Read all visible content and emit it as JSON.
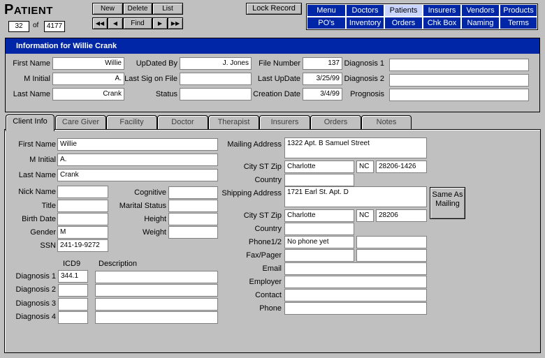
{
  "app": {
    "title_big": "P",
    "title_small": "ATIENT"
  },
  "record": {
    "current": "32",
    "of_label": "of",
    "total": "4177"
  },
  "toolbar": {
    "new": "New",
    "delete": "Delete",
    "list": "List",
    "first": "◀◀",
    "prev": "◀",
    "find": "Find",
    "next": "▶",
    "last": "▶▶",
    "lock": "Lock Record"
  },
  "nav": [
    "Menu",
    "Doctors",
    "Patients",
    "Insurers",
    "Vendors",
    "Products",
    "PO's",
    "Inventory",
    "Orders",
    "Chk Box",
    "Naming",
    "Terms"
  ],
  "info": {
    "header": "Information for Willie Crank",
    "first_name_label": "First Name",
    "first_name": "Willie",
    "m_initial_label": "M Initial",
    "m_initial": "A.",
    "last_name_label": "Last Name",
    "last_name": "Crank",
    "updated_by_label": "UpDated By",
    "updated_by": "J. Jones",
    "last_sig_label": "Last Sig on File",
    "last_sig": "",
    "status_label": "Status",
    "status": "",
    "file_number_label": "File Number",
    "file_number": "137",
    "last_update_label": "Last UpDate",
    "last_update": "3/25/99",
    "creation_date_label": "Creation Date",
    "creation_date": "3/4/99",
    "diag1_label": "Diagnosis 1",
    "diag1": "",
    "diag2_label": "Diagnosis 2",
    "diag2": "",
    "prognosis_label": "Prognosis",
    "prognosis": ""
  },
  "tabs": [
    "Client Info",
    "Care Giver",
    "Facility",
    "Doctor",
    "Therapist",
    "Insurers",
    "Orders",
    "Notes"
  ],
  "client": {
    "first_name_label": "First Name",
    "first_name": "Willie",
    "m_initial_label": "M Initial",
    "m_initial": "A.",
    "last_name_label": "Last Name",
    "last_name": "Crank",
    "nick_label": "Nick Name",
    "nick": "",
    "title_label": "Title",
    "title": "",
    "birth_label": "Birth Date",
    "birth": "",
    "gender_label": "Gender",
    "gender": "M",
    "ssn_label": "SSN",
    "ssn": "241-19-9272",
    "cognitive_label": "Cognitive",
    "cognitive": "",
    "marital_label": "Marital Status",
    "marital": "",
    "height_label": "Height",
    "height": "",
    "weight_label": "Weight",
    "weight": "",
    "icd9_label": "ICD9",
    "desc_label": "Description",
    "diagnoses": [
      {
        "label": "Diagnosis 1",
        "icd9": "344.1",
        "desc": ""
      },
      {
        "label": "Diagnosis 2",
        "icd9": "",
        "desc": ""
      },
      {
        "label": "Diagnosis 3",
        "icd9": "",
        "desc": ""
      },
      {
        "label": "Diagnosis 4",
        "icd9": "",
        "desc": ""
      }
    ],
    "mailing_label": "Mailing Address",
    "mailing": "1322 Apt. B Samuel Street",
    "city_st_zip_label": "City ST Zip",
    "mail_city": "Charlotte",
    "mail_state": "NC",
    "mail_zip": "28206-1426",
    "country_label": "Country",
    "mail_country": "",
    "shipping_label": "Shipping Address",
    "shipping": "1721 Earl St. Apt. D",
    "ship_city": "Charlotte",
    "ship_state": "NC",
    "ship_zip": "28206",
    "ship_country": "",
    "same_as_mailing": "Same As\nMailing",
    "phone12_label": "Phone1/2",
    "phone1": "No phone yet",
    "phone2": "",
    "fax_label": "Fax/Pager",
    "fax": "",
    "pager": "",
    "email_label": "Email",
    "email": "",
    "employer_label": "Employer",
    "employer": "",
    "contact_label": "Contact",
    "contact": "",
    "phone_label": "Phone",
    "phone": ""
  }
}
